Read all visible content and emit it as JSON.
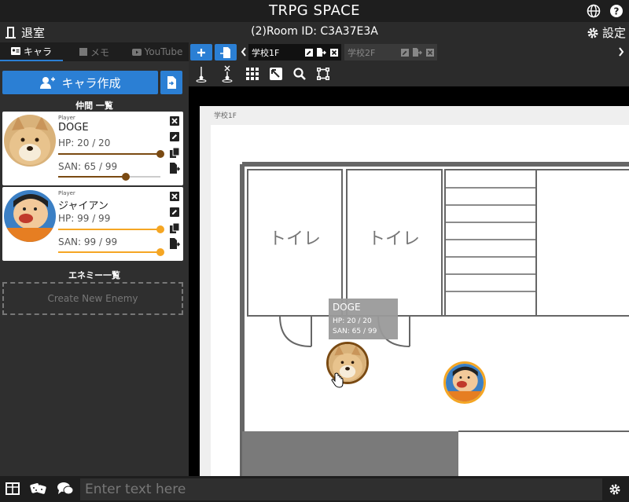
{
  "app": {
    "title": "TRPG SPACE"
  },
  "room": {
    "exit_label": "退室",
    "room_id": "(2)Room ID: C3A37E3A",
    "settings_label": "設定"
  },
  "sidebar": {
    "tabs": [
      {
        "label": "キャラ",
        "icon": "id-card-icon",
        "active": true
      },
      {
        "label": "メモ",
        "icon": "memo-icon",
        "active": false
      },
      {
        "label": "YouTube",
        "icon": "youtube-icon",
        "active": false
      }
    ],
    "create_label": "キャラ作成",
    "party_heading": "仲間 一覧",
    "enemy_heading": "エネミー一覧",
    "enemy_placeholder": "Create New Enemy",
    "characters": [
      {
        "type": "Player",
        "name": "DOGE",
        "hp_text": "HP: 20 / 20",
        "san_text": "SAN: 65 / 99",
        "hp_fraction": 1.0,
        "san_fraction": 0.66,
        "color": "#7a4a12"
      },
      {
        "type": "Player",
        "name": "ジャイアン",
        "hp_text": "HP: 99 / 99",
        "san_text": "SAN: 99 / 99",
        "hp_fraction": 1.0,
        "san_fraction": 1.0,
        "color": "#f5a623"
      }
    ]
  },
  "map": {
    "tabs": [
      {
        "label": "学校1F",
        "active": true
      },
      {
        "label": "学校2F",
        "active": false
      }
    ],
    "sheet_title": "学校1F",
    "rooms": [
      "トイレ",
      "トイレ"
    ],
    "tooltip": {
      "name": "DOGE",
      "hp": "HP: 20 / 20",
      "san": "SAN: 65 / 99"
    }
  },
  "chat": {
    "placeholder": "Enter text here"
  },
  "colors": {
    "accent": "#2b7fd4",
    "topbar": "#1e1e1e",
    "panel": "#2f2f2f"
  }
}
